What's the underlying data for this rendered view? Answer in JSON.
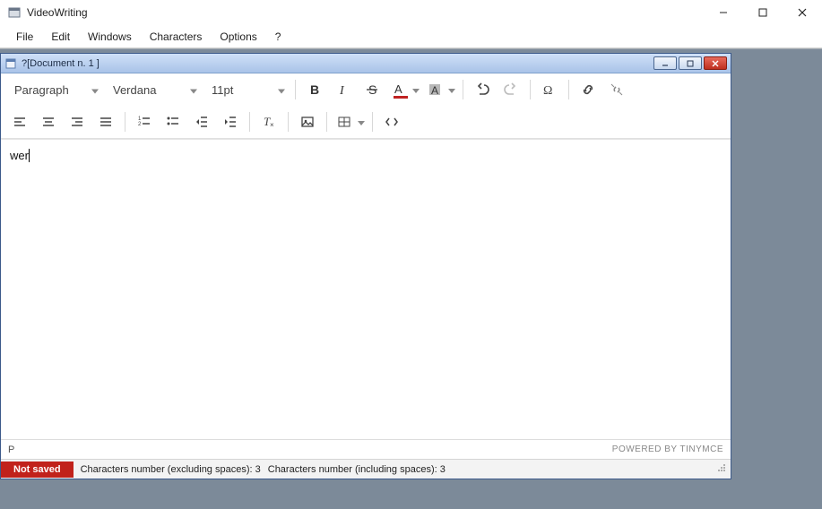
{
  "window": {
    "title": "VideoWriting"
  },
  "menu": {
    "items": [
      "File",
      "Edit",
      "Windows",
      "Characters",
      "Options",
      "?"
    ]
  },
  "document": {
    "title": "?[Document n. 1 ]",
    "content": "wer"
  },
  "toolbar": {
    "block_format": "Paragraph",
    "font_family": "Verdana",
    "font_size": "11pt",
    "text_color": "#c02222",
    "back_color": "#b8b8b8"
  },
  "editor_status": {
    "path": "P",
    "powered": "POWERED BY TINYMCE"
  },
  "bottom_status": {
    "save_state": "Not saved",
    "chars_excl_label": "Characters number (excluding spaces):",
    "chars_excl_val": "3",
    "chars_incl_label": "Characters number (including spaces):",
    "chars_incl_val": "3"
  }
}
